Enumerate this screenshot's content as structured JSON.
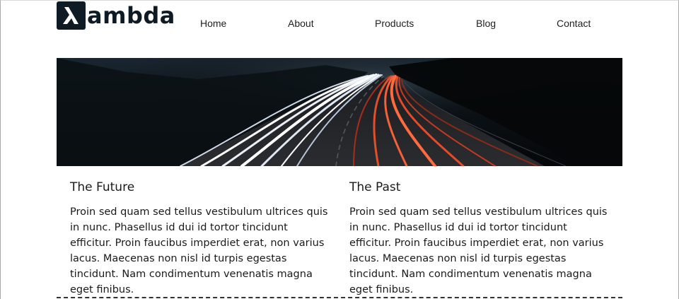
{
  "brand": {
    "logo_glyph": "λ",
    "logo_text": "ambda",
    "logo_color": "#0e1a24"
  },
  "nav": [
    {
      "label": "Home"
    },
    {
      "label": "About"
    },
    {
      "label": "Products"
    },
    {
      "label": "Blog"
    },
    {
      "label": "Contact"
    }
  ],
  "hero": {
    "subject": "long-exposure highway light trails at night"
  },
  "columns": [
    {
      "title": "The Future",
      "body": "Proin sed quam sed tellus vestibulum ultrices quis in nunc. Phasellus id dui id tortor tincidunt efficitur. Proin faucibus imperdiet erat, non varius lacus. Maecenas non nisl id turpis egestas tincidunt. Nam condimentum venenatis magna eget finibus."
    },
    {
      "title": "The Past",
      "body": "Proin sed quam sed tellus vestibulum ultrices quis in nunc. Phasellus id dui id tortor tincidunt efficitur. Proin faucibus imperdiet erat, non varius lacus. Maecenas non nisl id turpis egestas tincidunt. Nam condimentum venenatis magna eget finibus."
    }
  ]
}
